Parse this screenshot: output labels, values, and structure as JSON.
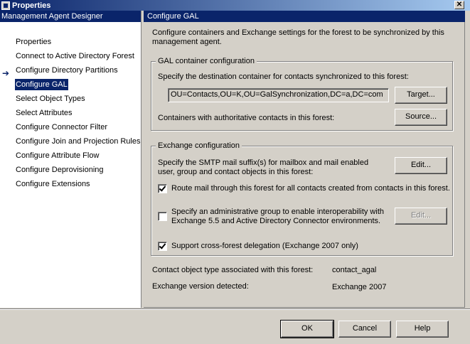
{
  "window": {
    "title": "Properties",
    "close_icon": "close-icon"
  },
  "nav": {
    "header": "Management Agent Designer",
    "items": [
      {
        "label": "Properties"
      },
      {
        "label": "Connect to Active Directory Forest"
      },
      {
        "label": "Configure Directory Partitions"
      },
      {
        "label": "Configure GAL"
      },
      {
        "label": "Select Object Types"
      },
      {
        "label": "Select Attributes"
      },
      {
        "label": "Configure Connector Filter"
      },
      {
        "label": "Configure Join and Projection Rules"
      },
      {
        "label": "Configure Attribute Flow"
      },
      {
        "label": "Configure Deprovisioning"
      },
      {
        "label": "Configure Extensions"
      }
    ],
    "selected_index": 3
  },
  "content": {
    "header": "Configure GAL",
    "intro": "Configure containers and Exchange settings for the forest to be synchronized by this management agent.",
    "gal_group": {
      "legend": "GAL container configuration",
      "dest_label": "Specify the destination container for contacts synchronized to this forest:",
      "dest_value": "OU=Contacts,OU=K,OU=GalSynchronization,DC=a,DC=com",
      "target_button": "Target...",
      "auth_label": "Containers with authoritative contacts in this forest:",
      "source_button": "Source..."
    },
    "exchange_group": {
      "legend": "Exchange configuration",
      "smtp_label": "Specify the SMTP mail suffix(s) for mailbox and mail enabled user, group and contact objects in this forest:",
      "edit_button": "Edit...",
      "route_label": "Route mail through this forest for all contacts created from contacts in this forest.",
      "route_checked": true,
      "admin_label": "Specify an administrative group to enable interoperability with Exchange 5.5 and Active Directory Connector environments.",
      "admin_checked": false,
      "admin_edit_button": "Edit...",
      "crossforest_label": "Support cross-forest delegation (Exchange 2007 only)",
      "crossforest_checked": true
    },
    "contact_type_label": "Contact object type associated with this forest:",
    "contact_type_value": "contact_agal",
    "exchange_version_label": "Exchange version detected:",
    "exchange_version_value": "Exchange 2007"
  },
  "footer": {
    "ok": "OK",
    "cancel": "Cancel",
    "help": "Help"
  }
}
